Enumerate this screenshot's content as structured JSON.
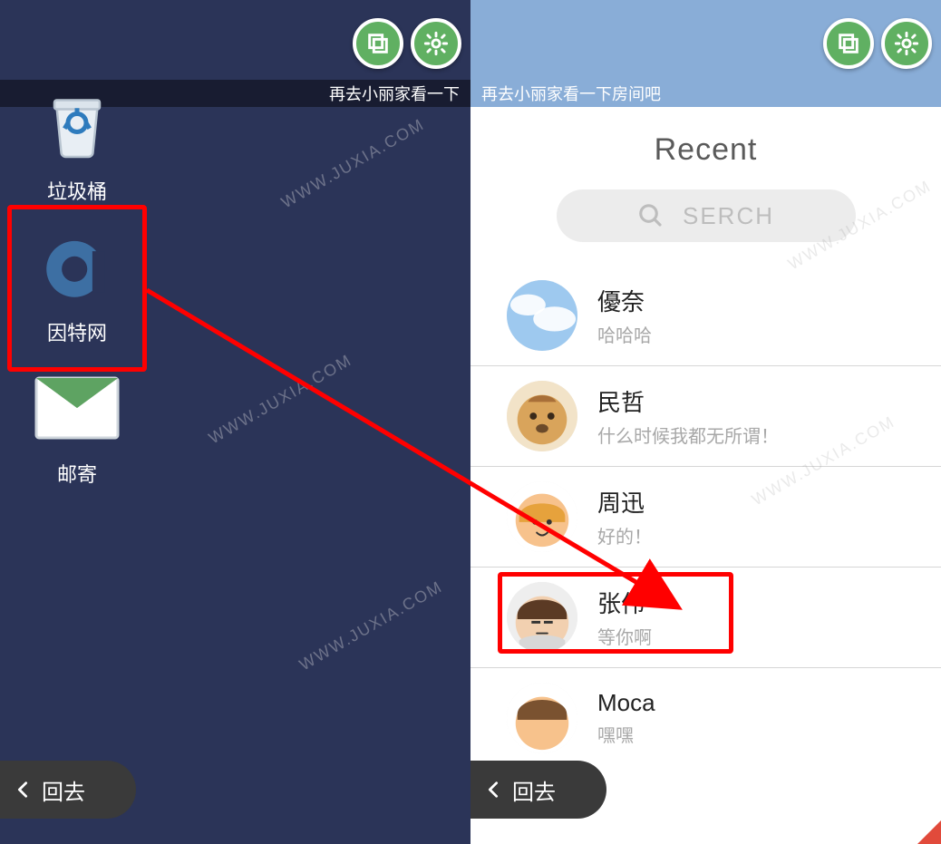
{
  "objective_left_partial": "再去小丽家看一下",
  "objective_right": "再去小丽家看一下房间吧",
  "back_label": "回去",
  "desk": {
    "trash": "垃圾桶",
    "internet": "因特网",
    "mail": "邮寄"
  },
  "recent": {
    "title": "Recent",
    "search_placeholder": "SERCH"
  },
  "chats": [
    {
      "name": "優奈",
      "msg": "哈哈哈"
    },
    {
      "name": "民哲",
      "msg": "什么时候我都无所谓！"
    },
    {
      "name": "周迅",
      "msg": "好的！"
    },
    {
      "name": "张伟",
      "msg": "等你啊"
    },
    {
      "name": "Moca",
      "msg": "嘿嘿"
    }
  ],
  "watermark": "WWW.JUXIA.COM",
  "colors": {
    "desktop_bg": "#2b3458",
    "header_blue": "#89add7",
    "btn_green": "#60b062",
    "highlight": "#ff0000"
  }
}
